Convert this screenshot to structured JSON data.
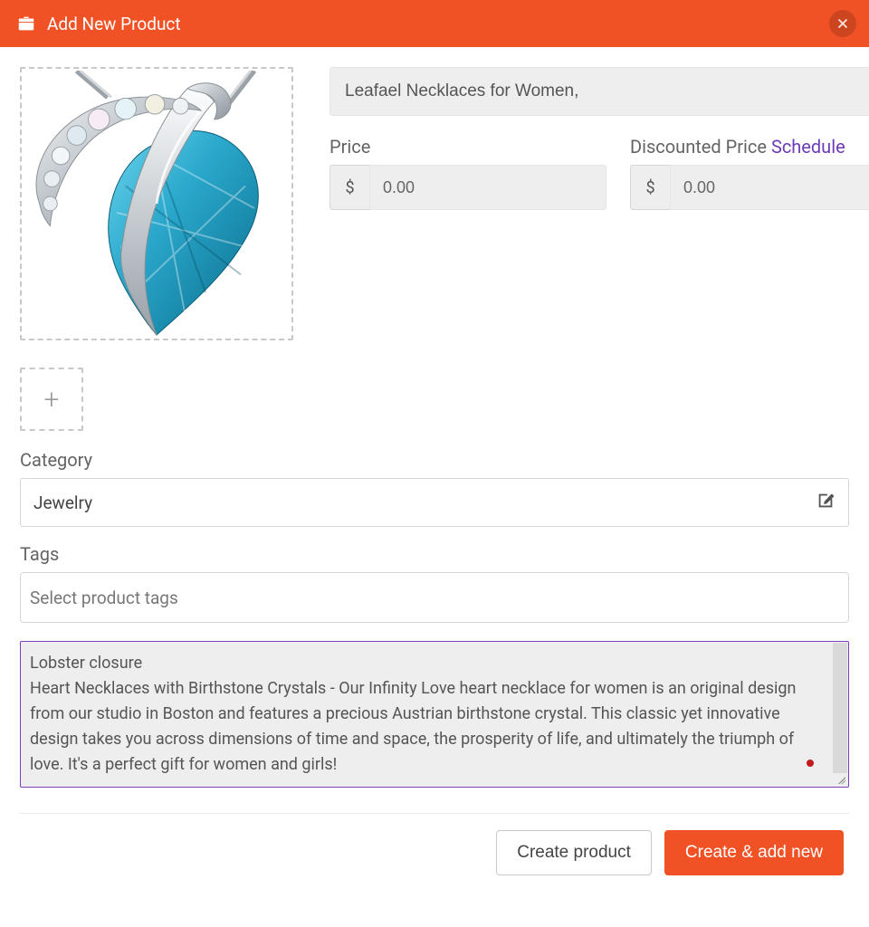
{
  "header": {
    "title": "Add New Product"
  },
  "product": {
    "name": "Leafael Necklaces for Women,"
  },
  "price": {
    "label": "Price",
    "currency": "$",
    "value": "0.00"
  },
  "discounted": {
    "label": "Discounted Price ",
    "schedule": "Schedule",
    "currency": "$",
    "value": "0.00"
  },
  "category": {
    "label": "Category",
    "value": "Jewelry"
  },
  "tags": {
    "label": "Tags",
    "placeholder": "Select product tags"
  },
  "description": {
    "value": "Lobster closure\nHeart Necklaces with Birthstone Crystals - Our Infinity Love heart necklace for women is an original design from our studio in Boston and features a precious Austrian birthstone crystal. This classic yet innovative design takes you across dimensions of time and space, the prosperity of life, and ultimately the triumph of love. It's a perfect gift for women and girls!"
  },
  "actions": {
    "create": "Create product",
    "create_add": "Create & add new"
  },
  "icons": {
    "plus": "+"
  }
}
